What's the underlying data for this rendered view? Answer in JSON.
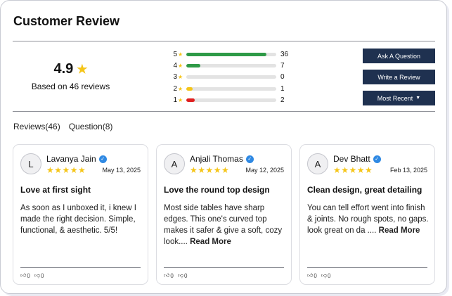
{
  "header": {
    "title": "Customer Review"
  },
  "summary": {
    "score": "4.9",
    "score_icon": "star-icon",
    "based_on": "Based on 46 reviews"
  },
  "distribution": [
    {
      "stars": "5",
      "count": "36",
      "fraction": 0.89,
      "color": "#2e9a47"
    },
    {
      "stars": "4",
      "count": "7",
      "fraction": 0.16,
      "color": "#2e9a47"
    },
    {
      "stars": "3",
      "count": "0",
      "fraction": 0.0,
      "color": "#2e9a47"
    },
    {
      "stars": "2",
      "count": "1",
      "fraction": 0.07,
      "color": "#f5c518"
    },
    {
      "stars": "1",
      "count": "2",
      "fraction": 0.09,
      "color": "#e02020"
    }
  ],
  "actions": {
    "ask_label": "Ask A Question",
    "write_label": "Write a Review",
    "sort_label": "Most Recent",
    "sort_icon": "caret-down-icon"
  },
  "tabs": [
    {
      "label": "Reviews(46)"
    },
    {
      "label": "Question(8)"
    }
  ],
  "reviews": [
    {
      "initial": "L",
      "name": "Lavanya Jain",
      "rating": 5,
      "date": "May 13, 2025",
      "title": "Love at first sight",
      "body": "As soon as I unboxed it, i knew I made the right decision. Simple, functional, & aesthetic. 5/5!",
      "read_more": "",
      "likes": "0",
      "dislikes": "0"
    },
    {
      "initial": "A",
      "name": "Anjali Thomas",
      "rating": 5,
      "date": "May 12, 2025",
      "title": "Love the round top design",
      "body": "Most side tables have sharp edges. This one's curved top makes it safer & give a soft, cozy look....",
      "read_more": "Read More",
      "likes": "0",
      "dislikes": "0"
    },
    {
      "initial": "A",
      "name": "Dev Bhatt",
      "rating": 5,
      "date": "Feb 13, 2025",
      "title": "Clean design, great detailing",
      "body": "You can tell effort went into finish & joints. No rough spots, no gaps. look great on da ....",
      "read_more": "Read More",
      "likes": "0",
      "dislikes": "0"
    }
  ],
  "colors": {
    "button_bg": "#1f3150",
    "star": "#f5c518",
    "verified": "#2f89e3"
  }
}
